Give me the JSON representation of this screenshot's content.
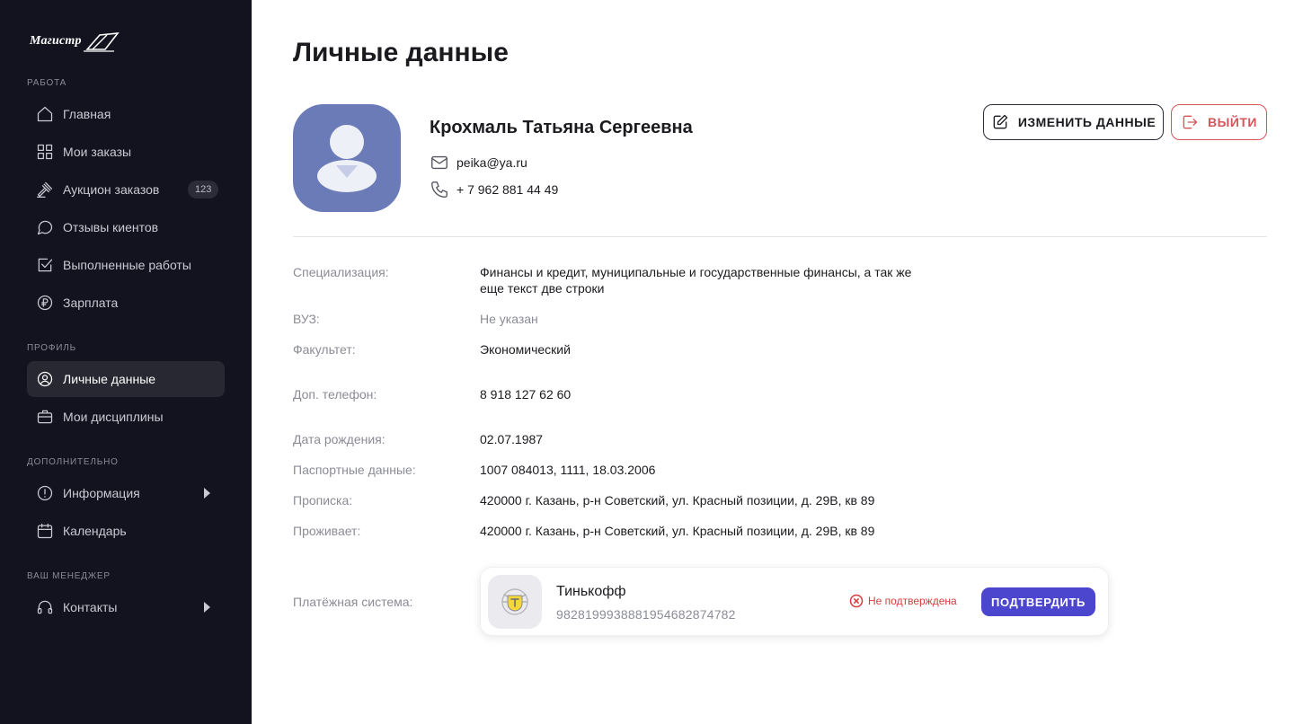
{
  "sidebar": {
    "logo_text": "Магистр",
    "sections": {
      "work": "РАБОТА",
      "profile": "ПРОФИЛЬ",
      "extra": "ДОПОЛНИТЕЛЬНО",
      "manager": "ВАШ МЕНЕДЖЕР"
    },
    "items": {
      "home": {
        "label": "Главная",
        "icon": "home-icon"
      },
      "orders": {
        "label": "Мои заказы",
        "icon": "grid-icon"
      },
      "auction": {
        "label": "Аукцион заказов",
        "icon": "gavel-icon",
        "badge": "123"
      },
      "reviews": {
        "label": "Отзывы киентов",
        "icon": "chat-bubble-icon"
      },
      "completed": {
        "label": "Выполненные работы",
        "icon": "checkbox-icon"
      },
      "salary": {
        "label": "Зарплата",
        "icon": "ruble-icon"
      },
      "personal": {
        "label": "Личные данные",
        "icon": "user-circle-icon",
        "active": true
      },
      "disciplines": {
        "label": "Мои дисциплины",
        "icon": "briefcase-icon"
      },
      "info": {
        "label": "Информация",
        "icon": "alert-circle-icon"
      },
      "calendar": {
        "label": "Календарь",
        "icon": "calendar-icon"
      },
      "contacts": {
        "label": "Контакты",
        "icon": "headset-icon"
      }
    }
  },
  "page": {
    "title": "Личные данные"
  },
  "profile": {
    "full_name": "Крохмаль Татьяна Сергеевна",
    "email": "peika@ya.ru",
    "phone": "+ 7 962 881 44 49",
    "edit_button": "ИЗМЕНИТЬ ДАННЫЕ",
    "logout_button": "ВЫЙТИ"
  },
  "fields": {
    "specialization": {
      "label": "Специализация:",
      "value": "Финансы и кредит, муниципальные и государственные финансы, а так же еще текст  две строки"
    },
    "university": {
      "label": "ВУЗ:",
      "value": "Не указан"
    },
    "faculty": {
      "label": "Факультет:",
      "value": "Экономический"
    },
    "extra_phone": {
      "label": "Доп. телефон:",
      "value": "8 918 127 62 60"
    },
    "birth_date": {
      "label": "Дата рождения:",
      "value": "02.07.1987"
    },
    "passport": {
      "label": "Паспортные данные:",
      "value": "1007 084013, 1111, 18.03.2006"
    },
    "registration": {
      "label": "Прописка:",
      "value": "420000 г. Казань, р-н Советский, ул. Красный позиции, д. 29В, кв 89"
    },
    "residence": {
      "label": "Проживает:",
      "value": "420000 г. Казань, р-н Советский, ул. Красный позиции, д. 29В, кв 89"
    }
  },
  "payment": {
    "label": "Платёжная система:",
    "bank_name": "Тинькофф",
    "account": "9828199938881954682874782",
    "status": "Не подтверждена",
    "confirm_button": "ПОДТВЕРДИТЬ"
  },
  "colors": {
    "sidebar_bg": "#13131f",
    "active_item_bg": "#282833",
    "accent": "#4c46cf",
    "danger": "#d4555a",
    "avatar_bg": "#6b7bb8"
  }
}
